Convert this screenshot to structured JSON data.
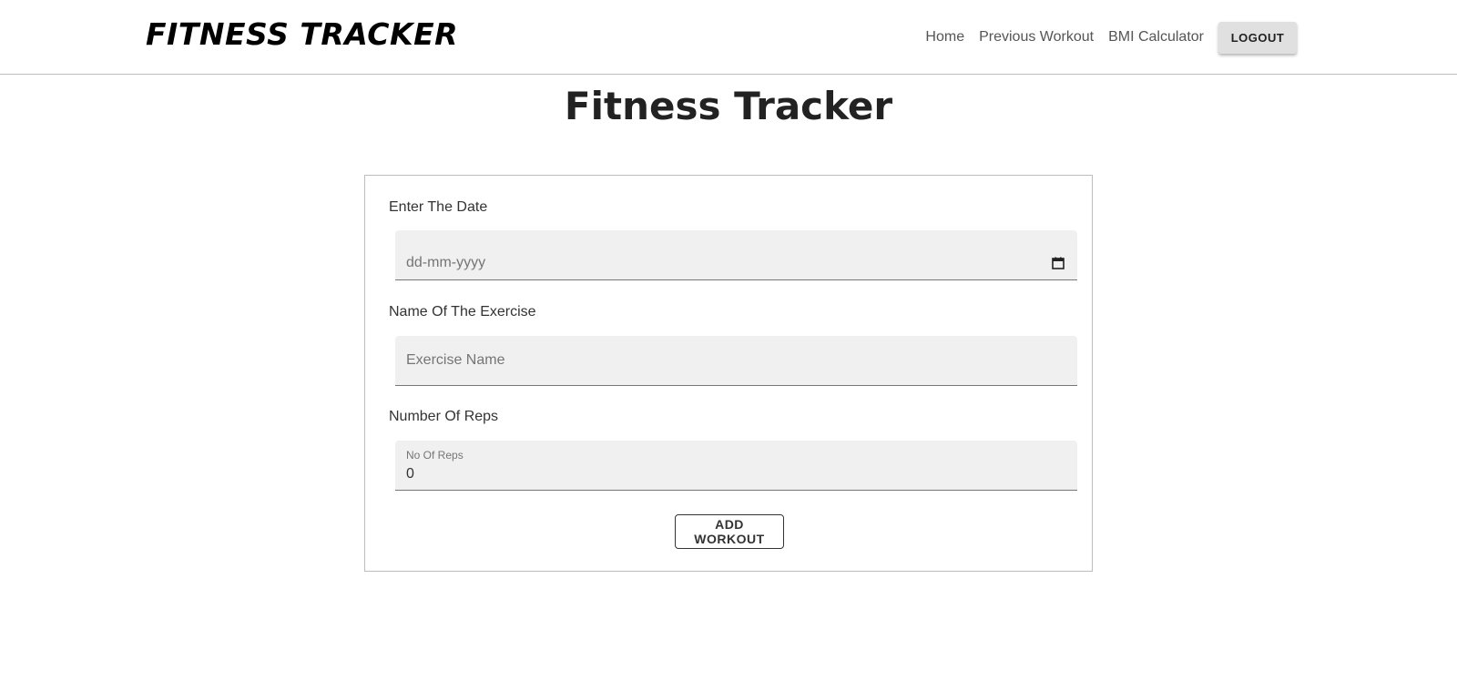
{
  "navbar": {
    "brand": "FITNESS TRACKER",
    "links": [
      "Home",
      "Previous Workout",
      "BMI Calculator"
    ],
    "logout_label": "LOGOUT"
  },
  "page": {
    "title": "Fitness Tracker"
  },
  "form": {
    "date": {
      "label": "Enter The Date",
      "placeholder": "dd-mm-yyyy",
      "icon": "calendar-icon"
    },
    "exercise": {
      "label": "Name Of The Exercise",
      "placeholder": "Exercise Name"
    },
    "reps": {
      "label": "Number Of Reps",
      "inner_label": "No Of Reps",
      "value": "0"
    },
    "submit_label": "ADD WORKOUT"
  }
}
